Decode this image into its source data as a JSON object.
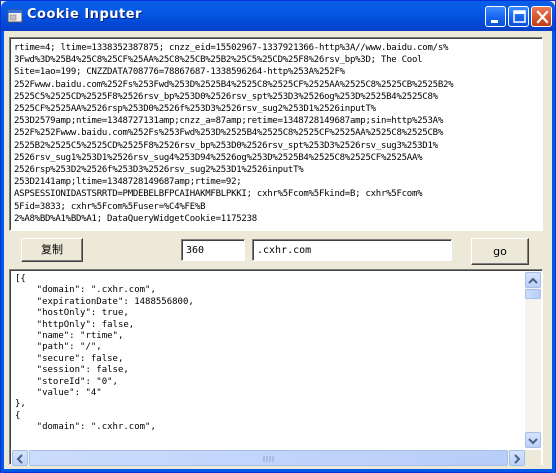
{
  "window": {
    "title": "Cookie Inputer",
    "colors": {
      "titlebar": "#0458e6",
      "close_button": "#d9532b",
      "face": "#ece9d8"
    }
  },
  "cookies_text": "rtime=4; ltime=1338352387875; cnzz_eid=15502967-1337921366-http%3A//www.baidu.com/s%\n3Fwd%3D%25B4%25C8%25CF%25AA%25C8%25CB%25B2%25C5%25CD%25F8%26rsv_bp%3D; The Cool\nSite=1ao=199; CNZZDATA70877​6=78867687-1338596264-http%253A%252F%\n252Fwww.baidu.com%252Fs%253Fwd%253D%2525B4%2525C8%2525CF%2525AA%2525C8%2525CB%2525B2%\n2525C5%2525CD%2525F8%2526rsv_bp%253D0%2526rsv_spt%253D3%2526og%253D%2525B4%2525C8%\n2525CF%2525AA%2526rsp%253D0%2526f%253D3%2526rsv_sug2%253D1%2526inputT%\n253D2579amp;ntime=1348727131amp;cnzz_a=87amp;retime=1348728149687amp;sin=http%253A%\n252F%252Fwww.baidu.com%252Fs%253Fwd%253D%2525B4%2525C8%2525CF%2525AA%2525C8%2525CB%\n2525B2%2525C5%2525CD%2525F8%2526rsv_bp%253D0%2526rsv_spt%253D3%2526rsv_sug3%253D1%\n2526rsv_sug1%253D1%2526rsv_sug4%253D94%2526og%253D%2525B4%2525C8%2525CF%2525AA%\n2526rsp%253D2%2526f%253D3%2526rsv_sug2%253D1%2526inputT%\n253D2141amp;ltime=1348728149687amp;rtime=92;\nASPSESSIONIDASTSRRTD=PMDEBELBFPCAIHAKMFBLPKKI; cxhr%5Fcom%5Fkind=B; cxhr%5Fcom%\n5Fid=3833; cxhr%5Fcom%5Fuser=%C4%FE%B\n2%A8%BD%A1%BD%A1; DataQueryWidgetCookie=1175238",
  "controls": {
    "copy_label": "复制",
    "number_value": "360",
    "domain_value": ".cxhr.com",
    "go_label": "go"
  },
  "json_output": "[{\n    \"domain\": \".cxhr.com\",\n    \"expirationDate\": 1488556800,\n    \"hostOnly\": true,\n    \"httpOnly\": false,\n    \"name\": \"rtime\",\n    \"path\": \"/\",\n    \"secure\": false,\n    \"session\": false,\n    \"storeId\": \"0\",\n    \"value\": \"4\"\n},\n{\n    \"domain\": \".cxhr.com\","
}
